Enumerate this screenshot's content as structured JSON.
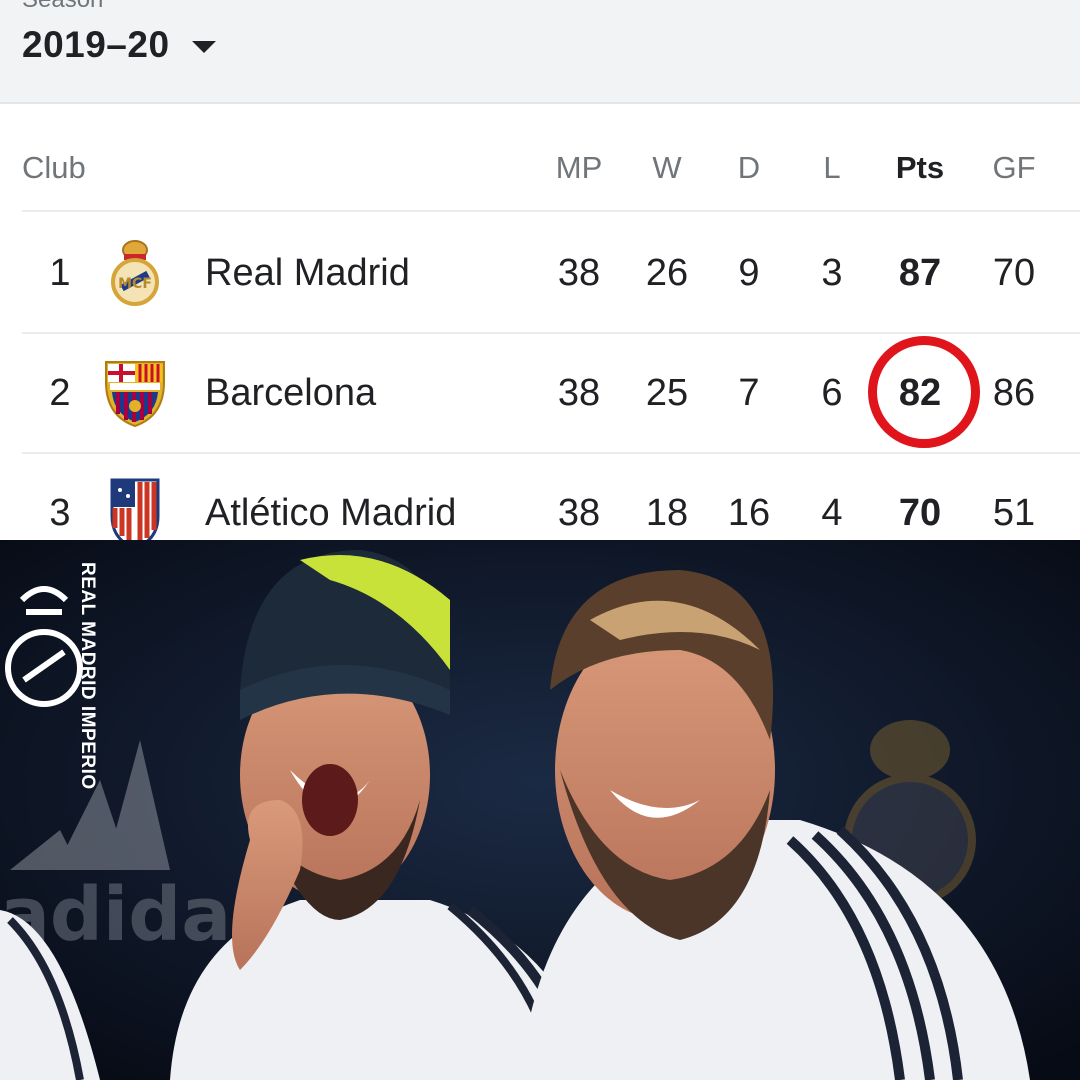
{
  "season": {
    "label": "Season",
    "value": "2019–20"
  },
  "table": {
    "headers": {
      "club": "Club",
      "mp": "MP",
      "w": "W",
      "d": "D",
      "l": "L",
      "pts": "Pts",
      "gf": "GF"
    },
    "rows": [
      {
        "rank": "1",
        "club": "Real Madrid",
        "crest": "real-madrid-crest-icon",
        "mp": "38",
        "w": "26",
        "d": "9",
        "l": "3",
        "pts": "87",
        "gf": "70"
      },
      {
        "rank": "2",
        "club": "Barcelona",
        "crest": "barcelona-crest-icon",
        "mp": "38",
        "w": "25",
        "d": "7",
        "l": "6",
        "pts": "82",
        "gf": "86"
      },
      {
        "rank": "3",
        "club": "Atlético Madrid",
        "crest": "atletico-madrid-crest-icon",
        "mp": "38",
        "w": "18",
        "d": "16",
        "l": "4",
        "pts": "70",
        "gf": "51"
      }
    ],
    "highlighted_value": "82",
    "highlight_color": "#e0141b"
  },
  "photo": {
    "description_icon": "two-laughing-players-photo",
    "watermark_text": "REAL MADRID IMPERIO",
    "background_logo_text": "adidas"
  }
}
